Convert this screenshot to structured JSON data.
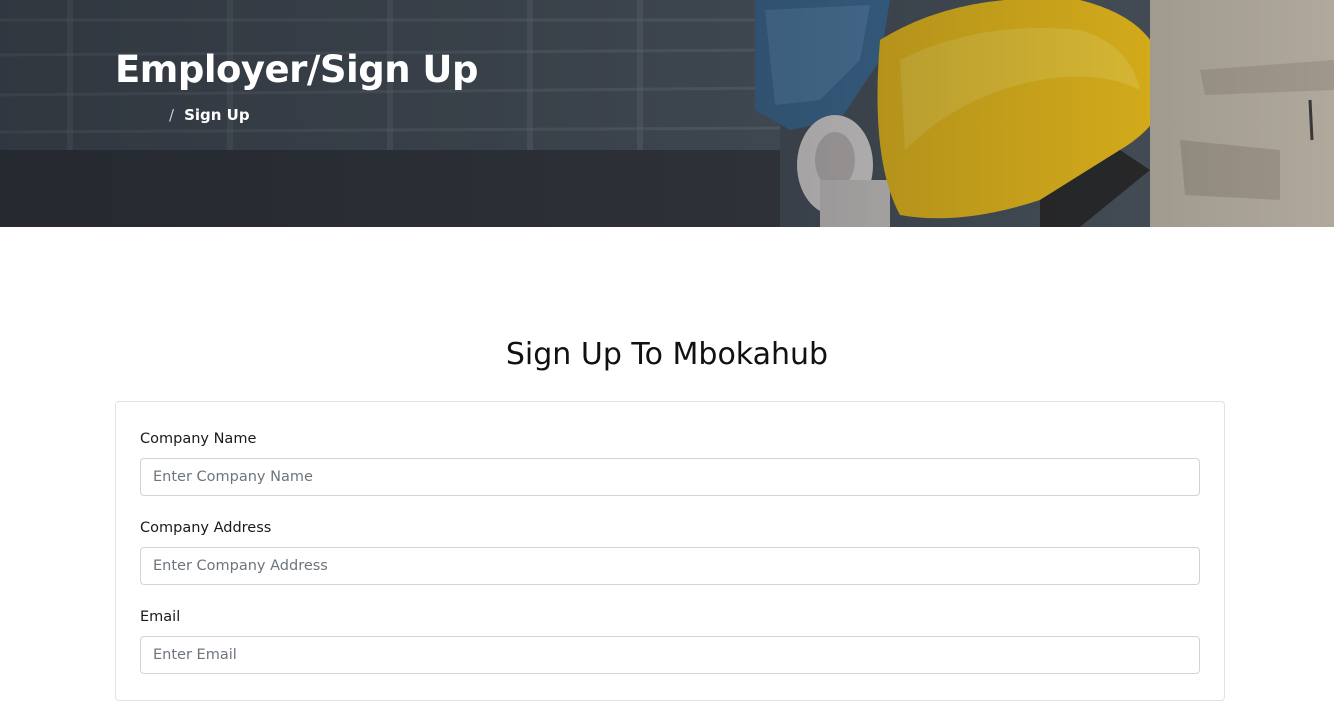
{
  "hero": {
    "title": "Employer/Sign Up",
    "breadcrumb": {
      "separator": "/",
      "current": "Sign Up"
    }
  },
  "form": {
    "heading": "Sign Up To Mbokahub",
    "fields": [
      {
        "label": "Company Name",
        "placeholder": "Enter Company Name"
      },
      {
        "label": "Company Address",
        "placeholder": "Enter Company Address"
      },
      {
        "label": "Email",
        "placeholder": "Enter Email"
      }
    ]
  },
  "colors": {
    "helmet": "#f2c21a",
    "title_text": "#ffffff",
    "input_border": "#ced4da"
  }
}
